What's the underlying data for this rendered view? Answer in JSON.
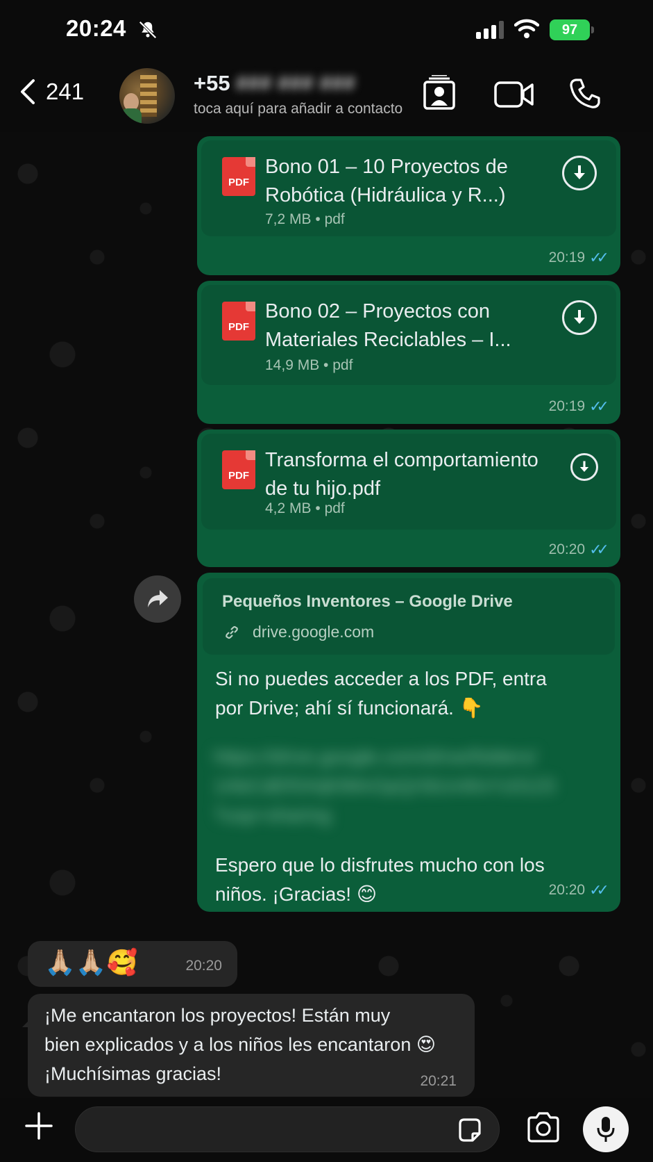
{
  "status": {
    "time": "20:24",
    "battery": "97"
  },
  "header": {
    "back_count": "241",
    "contact_prefix": "+55",
    "contact_number_blurred": "### ### ###",
    "subtitle": "toca aquí para añadir a contacto"
  },
  "messages": {
    "doc1": {
      "title_line1": "Bono 01 – 10 Proyectos de",
      "title_line2": "Robótica (Hidráulica y R...)",
      "size": "7,2 MB",
      "ext": "pdf",
      "time": "20:19",
      "icon_label": "PDF"
    },
    "doc2": {
      "title_line1": "Bono 02 – Proyectos con",
      "title_line2": "Materiales Reciclables – I...",
      "size": "14,9 MB",
      "ext": "pdf",
      "time": "20:19",
      "icon_label": "PDF"
    },
    "doc3": {
      "title_line1": "Transforma el comportamiento",
      "title_line2": "de tu hijo.pdf",
      "size": "4,2 MB",
      "ext": "pdf",
      "time": "20:20",
      "icon_label": "PDF"
    },
    "link_msg": {
      "link_title": "Pequeños Inventores – Google Drive",
      "link_url": "drive.google.com",
      "text_line1": "Si no puedes acceder a los PDF, entra",
      "text_line2": "por Drive; ahí sí funcionará. 👇",
      "blurred_line1": "https://drive.google.com/drive/folders/",
      "blurred_line2": "1AbCdEfGhIjKlMnOpQrStUvWxYz0123",
      "blurred_line3": "?usp=sharing",
      "text_line3": "Espero que lo disfrutes mucho con los",
      "text_line4": "niños. ¡Gracias! 😊",
      "time": "20:20"
    },
    "in1": {
      "text": "🙏🏼🙏🏼🥰",
      "time": "20:20"
    },
    "in2": {
      "line1": "¡Me encantaron los proyectos! Están muy",
      "line2": "bien explicados y a los niños les encantaron 😍",
      "line3": "¡Muchísimas gracias!",
      "time": "20:21"
    }
  },
  "ticks": "✓✓",
  "colors": {
    "bubble_out": "#0b5e3a",
    "bubble_in": "#262626",
    "read_ticks": "#53bdeb",
    "battery": "#30d158"
  }
}
